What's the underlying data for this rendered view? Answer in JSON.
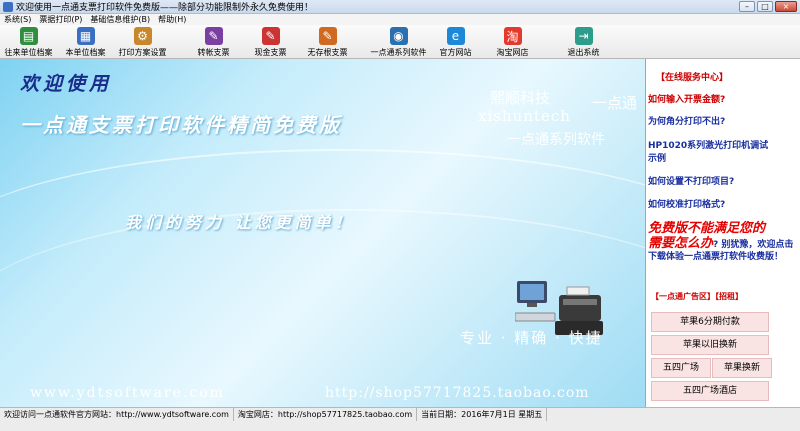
{
  "window": {
    "title": "欢迎使用一点通支票打印软件免费版——除部分功能限制外永久免费使用！",
    "controls": [
      "–",
      "□",
      "×"
    ]
  },
  "menu": [
    "系统(S)",
    "票据打印(P)",
    "基础信息维护(B)",
    "帮助(H)"
  ],
  "toolbar": [
    {
      "label": "往来单位档案",
      "icon": "contacts-icon",
      "color": "#2f8f3f",
      "glyph": "▤"
    },
    {
      "label": "本单位档案",
      "icon": "company-icon",
      "color": "#3a6fc2",
      "glyph": "▦"
    },
    {
      "label": "打印方案设置",
      "icon": "print-settings-icon",
      "color": "#c8872a",
      "glyph": "⚙"
    },
    {
      "label": "转帐支票",
      "icon": "transfer-check-icon",
      "color": "#7a3fa0",
      "glyph": "✎"
    },
    {
      "label": "现金支票",
      "icon": "cash-check-icon",
      "color": "#cc3333",
      "glyph": "✎"
    },
    {
      "label": "无存根支票",
      "icon": "stubless-check-icon",
      "color": "#d06a20",
      "glyph": "✎"
    },
    {
      "label": "一点通系列软件",
      "icon": "software-series-icon",
      "color": "#2a6fb0",
      "glyph": "◉"
    },
    {
      "label": "官方网站",
      "icon": "website-icon",
      "color": "#1e88d8",
      "glyph": "e"
    },
    {
      "label": "淘宝网店",
      "icon": "taobao-icon",
      "color": "#e23b2e",
      "glyph": "淘"
    },
    {
      "label": "退出系统",
      "icon": "exit-icon",
      "color": "#2b9d8a",
      "glyph": "⇥"
    }
  ],
  "banner": {
    "welcome": "欢迎使用",
    "product": "一点通支票打印软件精简免费版",
    "brand_cn": "熙顺科技",
    "brand_cn2": "一点通",
    "brand_en": "xishuntech",
    "series": "一点通系列软件",
    "slogan": "我们的努力  让您更简单！",
    "tagline": "专业 · 精确 · 快捷",
    "url_site": "www.ydtsoftware.com",
    "url_shop": "http://shop57717825.taobao.com"
  },
  "sidebar": {
    "service_title": "【在线服务中心】",
    "faqs": [
      {
        "text": "如何输入开票金额?",
        "red": true
      },
      {
        "text": "为何角分打印不出?",
        "red": false
      },
      {
        "text": "HP1020系列激光打印机调试",
        "red": false
      },
      {
        "text": "示例",
        "red": false
      },
      {
        "text": "如何设置不打印项目?",
        "red": false
      },
      {
        "text": "如何校准打印格式?",
        "red": false
      }
    ],
    "promo_big1": "免费版不能满足您的",
    "promo_big2": "需要怎么办",
    "promo_text": "? 别犹豫，欢迎点击下载体验一点通票打软件收费版！",
    "ad_label": "【一点通广告区】【招租】",
    "ads": [
      "苹果6分期付款",
      "苹果以旧换新",
      "五四广场",
      "苹果换新",
      "五四广场酒店"
    ]
  },
  "status": {
    "site": "欢迎访问一点通软件官方网站：http://www.ydtsoftware.com",
    "shop": "淘宝网店：http://shop57717825.taobao.com",
    "date": "当前日期：2016年7月1日 星期五"
  }
}
